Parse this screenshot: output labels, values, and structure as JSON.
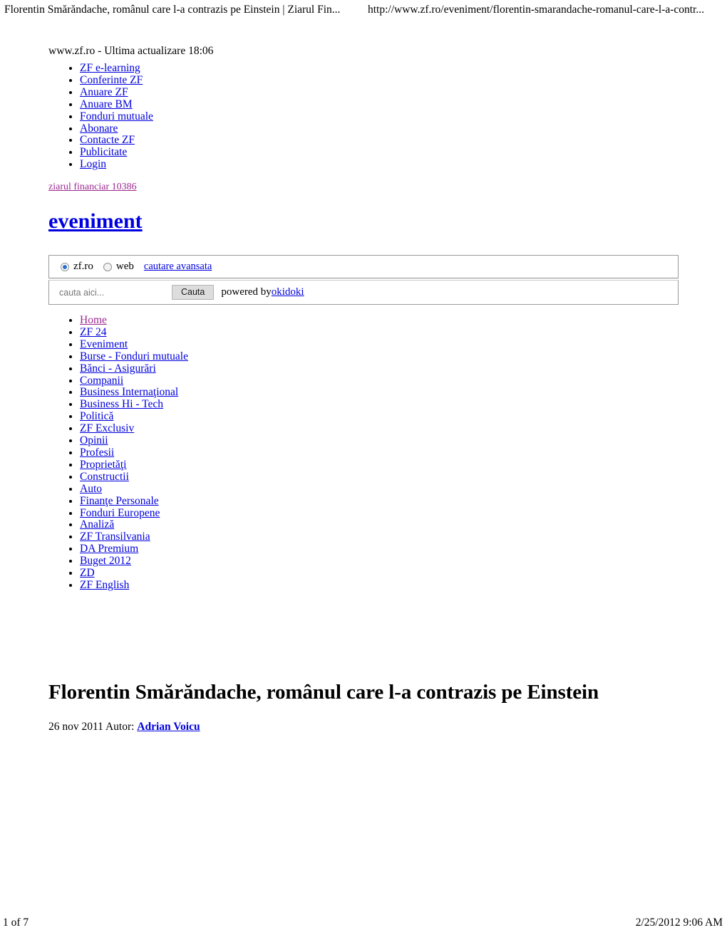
{
  "print_header": {
    "document_title": "Florentin Smărăndache, românul care l-a contrazis pe Einstein | Ziarul Fin...",
    "url": "http://www.zf.ro/eveniment/florentin-smarandache-romanul-care-l-a-contr..."
  },
  "print_footer": {
    "page_indicator": "1 of 7",
    "timestamp": "2/25/2012 9:06 AM"
  },
  "site": {
    "updated_line": "www.zf.ro - Ultima actualizare 18:06",
    "paper_link": "ziarul financiar 10386",
    "section_title": "eveniment"
  },
  "utility_nav": {
    "items": [
      {
        "label": "ZF e-learning"
      },
      {
        "label": "Conferinte ZF"
      },
      {
        "label": "Anuare ZF"
      },
      {
        "label": "Anuare BM"
      },
      {
        "label": "Fonduri mutuale"
      },
      {
        "label": "Abonare"
      },
      {
        "label": "Contacte ZF"
      },
      {
        "label": "Publicitate"
      },
      {
        "label": "Login"
      }
    ]
  },
  "search": {
    "scope_options": [
      {
        "label": "zf.ro",
        "selected": true
      },
      {
        "label": "web",
        "selected": false
      }
    ],
    "advanced_link": "cautare avansata",
    "placeholder": "cauta aici...",
    "value": "",
    "submit_label": "Cauta",
    "powered_by_text": "powered by",
    "powered_by_link": "okidoki"
  },
  "main_nav": {
    "items": [
      {
        "label": "Home",
        "visited": true
      },
      {
        "label": "ZF 24",
        "visited": false
      },
      {
        "label": "Eveniment",
        "visited": false
      },
      {
        "label": "Burse - Fonduri mutuale",
        "visited": false
      },
      {
        "label": "Bănci - Asigurări",
        "visited": false
      },
      {
        "label": "Companii",
        "visited": false
      },
      {
        "label": "Business Internaţional",
        "visited": false
      },
      {
        "label": "Business Hi - Tech",
        "visited": false
      },
      {
        "label": "Politică",
        "visited": false
      },
      {
        "label": "ZF Exclusiv",
        "visited": false
      },
      {
        "label": "Opinii",
        "visited": false
      },
      {
        "label": "Profesii",
        "visited": false
      },
      {
        "label": "Proprietăţi",
        "visited": false
      },
      {
        "label": "Constructii",
        "visited": false
      },
      {
        "label": "Auto",
        "visited": false
      },
      {
        "label": "Finanţe Personale",
        "visited": false
      },
      {
        "label": "Fonduri Europene",
        "visited": false
      },
      {
        "label": "Analiză",
        "visited": false
      },
      {
        "label": "ZF Transilvania",
        "visited": false
      },
      {
        "label": "DA Premium",
        "visited": false
      },
      {
        "label": "Buget 2012",
        "visited": false
      },
      {
        "label": "ZD",
        "visited": false
      },
      {
        "label": "ZF English",
        "visited": false
      }
    ]
  },
  "article": {
    "title": "Florentin Smărăndache, românul care l-a contrazis pe Einstein",
    "date_author_prefix": "26 nov 2011 Autor:",
    "author": "Adrian Voicu"
  },
  "colors": {
    "link": "#0000dd",
    "visited_link": "#9b2a8e",
    "heading_link": "#0000e0",
    "panel_border": "#9a9a9a",
    "button_bg": "#dddddd"
  }
}
